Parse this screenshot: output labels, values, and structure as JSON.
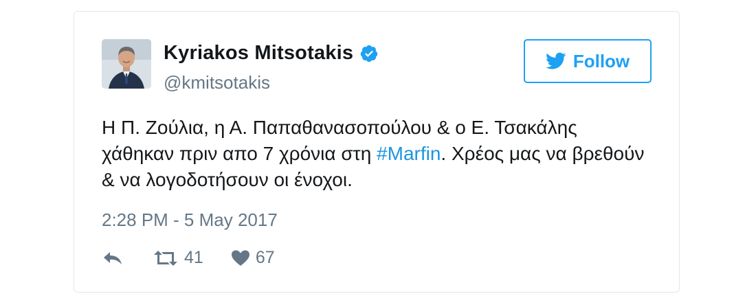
{
  "tweet": {
    "author": {
      "name": "Kyriakos Mitsotakis",
      "handle": "@kmitsotakis",
      "verified": true
    },
    "follow_button": {
      "label": "Follow"
    },
    "text": {
      "part1": "Η Π. Ζούλια, η Α. Παπαθανασοπούλου & ο Ε. Τσακάλης χάθηκαν πριν απο 7 χρόνια στη ",
      "hashtag": "#Marfin",
      "part2": ". Χρέος μας να βρεθούν & να λογοδοτήσουν οι ένοχοι."
    },
    "timestamp": "2:28 PM - 5 May 2017",
    "actions": {
      "retweet_count": "41",
      "like_count": "67"
    },
    "colors": {
      "accent": "#1da1f2",
      "hashtag": "#1b95e0",
      "muted": "#657786",
      "text": "#14171a",
      "border": "#e1e8ed"
    }
  }
}
